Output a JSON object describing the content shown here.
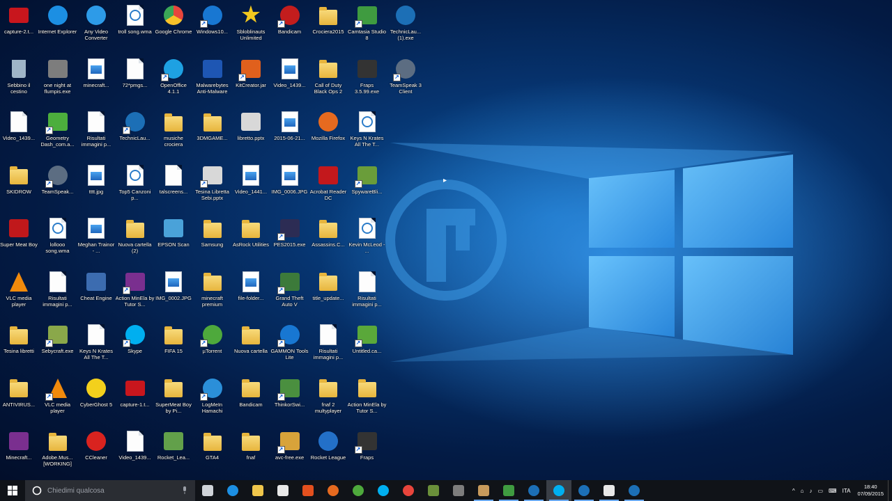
{
  "desktop": {
    "icons": [
      {
        "label": "capture-2.t...",
        "type": "video",
        "color": "#c8161d"
      },
      {
        "label": "Internet Explorer",
        "type": "ie",
        "color": "#1c8fe3"
      },
      {
        "label": "Any Video Converter",
        "type": "round",
        "color": "#2d9be8"
      },
      {
        "label": "troll song.wma",
        "type": "media",
        "color": "#2b7cc9"
      },
      {
        "label": "Google Chrome",
        "type": "chrome",
        "color": "#e8453c"
      },
      {
        "label": "Windows10...",
        "type": "round",
        "color": "#1877d2"
      },
      {
        "label": "Sbloblinauts Unlimited",
        "type": "star",
        "color": "#f3c81e"
      },
      {
        "label": "Bandicam",
        "type": "round",
        "color": "#c31d1d"
      },
      {
        "label": "Crociera2015",
        "type": "folder"
      },
      {
        "label": "Camtasia Studio 8",
        "type": "sq",
        "color": "#3f9b40"
      },
      {
        "label": "TechnicLau... (1).exe",
        "type": "round",
        "color": "#1c6fb6"
      },
      {
        "label": "Sebbino il cestino",
        "type": "bin",
        "color": "#9fb5c8"
      },
      {
        "label": "one night at flumpis.exe",
        "type": "sq",
        "color": "#7d7d7d"
      },
      {
        "label": "minecraft...",
        "type": "image"
      },
      {
        "label": "72*pmgs...",
        "type": "file"
      },
      {
        "label": "OpenOffice 4.1.1",
        "type": "round",
        "color": "#1ea1e2"
      },
      {
        "label": "Malwarebytes Anti-Malware",
        "type": "sq",
        "color": "#1e56b3"
      },
      {
        "label": "KitCreator.jar",
        "type": "sq",
        "color": "#e0601d"
      },
      {
        "label": "Video_1439...",
        "type": "image"
      },
      {
        "label": "Call of Duty Black Ops 2",
        "type": "folder"
      },
      {
        "label": "Fraps 3.5.99.exe",
        "type": "sq",
        "color": "#333333"
      },
      {
        "label": "TeamSpeak 3 Client",
        "type": "round",
        "color": "#5c6d82"
      },
      {
        "label": "Video_1439...",
        "type": "file"
      },
      {
        "label": "Geometry Dash_com.a...",
        "type": "sq",
        "color": "#4cae3d"
      },
      {
        "label": "Risultati immagini p...",
        "type": "file"
      },
      {
        "label": "TechnicLau...",
        "type": "round",
        "color": "#1c6fb6"
      },
      {
        "label": "musiche crociera",
        "type": "folder"
      },
      {
        "label": "3DMGAME...",
        "type": "folder"
      },
      {
        "label": "libretto.pptx",
        "type": "sq",
        "color": "#d8d8d8"
      },
      {
        "label": "2015-06-21...",
        "type": "image"
      },
      {
        "label": "Mozilla Firefox",
        "type": "round",
        "color": "#e66a1f"
      },
      {
        "label": "Keys N Krates All The T...",
        "type": "media",
        "color": "#2b7cc9"
      },
      {
        "label": "SKIDROW",
        "type": "folder"
      },
      {
        "label": "TeamSpeak...",
        "type": "round",
        "color": "#5c6d82"
      },
      {
        "label": "tttt.jpg",
        "type": "image"
      },
      {
        "label": "Top5 Canzoni p...",
        "type": "media",
        "color": "#2b7cc9"
      },
      {
        "label": "talscreens...",
        "type": "file"
      },
      {
        "label": "Tesina Libretta Sebi.pptx",
        "type": "sq",
        "color": "#d8d8d8"
      },
      {
        "label": "Video_1441...",
        "type": "image"
      },
      {
        "label": "IMG_0006.JPG",
        "type": "image"
      },
      {
        "label": "Acrobat Reader DC",
        "type": "sq",
        "color": "#c3181c"
      },
      {
        "label": "SpywareBli...",
        "type": "sq",
        "color": "#6a9d3a"
      },
      {
        "label": "Super Meat Boy",
        "type": "sq",
        "color": "#c0181b"
      },
      {
        "label": "lollooo song.wma",
        "type": "media",
        "color": "#2b7cc9"
      },
      {
        "label": "Meghan Trainor - ...",
        "type": "image"
      },
      {
        "label": "Nuova cartella (2)",
        "type": "folder"
      },
      {
        "label": "EPSON Scan",
        "type": "sq",
        "color": "#4aa2d9"
      },
      {
        "label": "Samsung",
        "type": "folder"
      },
      {
        "label": "AsRock Utilities",
        "type": "folder"
      },
      {
        "label": "PES2015.exe",
        "type": "sq",
        "color": "#2c2c54"
      },
      {
        "label": "Assassins.C...",
        "type": "folder"
      },
      {
        "label": "Kevin McLeod - ...",
        "type": "media",
        "color": "#2b7cc9"
      },
      {
        "label": "VLC media player",
        "type": "vlc",
        "color": "#f18a0c"
      },
      {
        "label": "Risultati immagini p...",
        "type": "file"
      },
      {
        "label": "Cheat Engine",
        "type": "sq",
        "color": "#3c6cb0"
      },
      {
        "label": "Action MinEla by Tutor S...",
        "type": "sq",
        "color": "#7a2f8f"
      },
      {
        "label": "IMG_0002.JPG",
        "type": "image"
      },
      {
        "label": "minecraft premium",
        "type": "folder"
      },
      {
        "label": "file-folder...",
        "type": "image"
      },
      {
        "label": "Grand Theft Auto V",
        "type": "sq",
        "color": "#3c7a3a"
      },
      {
        "label": "title_update...",
        "type": "folder"
      },
      {
        "label": "Risultati immagini p...",
        "type": "file"
      },
      {
        "label": "Tesina libretti",
        "type": "folder"
      },
      {
        "label": "Sebycraft.exe",
        "type": "sq",
        "color": "#8aa84a"
      },
      {
        "label": "Keys N Krates All The T...",
        "type": "file"
      },
      {
        "label": "Skype",
        "type": "round",
        "color": "#00aff0"
      },
      {
        "label": "FIFA 15",
        "type": "folder"
      },
      {
        "label": "µTorrent",
        "type": "round",
        "color": "#4ea93c"
      },
      {
        "label": "Nuova cartella",
        "type": "folder"
      },
      {
        "label": "GAMMON Tools Lite",
        "type": "round",
        "color": "#1877d2"
      },
      {
        "label": "Risultati immagini p...",
        "type": "file"
      },
      {
        "label": "Untitled.ca...",
        "type": "sq",
        "color": "#5aa83a"
      },
      {
        "label": "ANTIVIRUS...",
        "type": "folder"
      },
      {
        "label": "VLC media player",
        "type": "vlc",
        "color": "#f18a0c"
      },
      {
        "label": "CyberGhost 5",
        "type": "round",
        "color": "#f3d01c"
      },
      {
        "label": "capture-1.t...",
        "type": "video",
        "color": "#c8161d"
      },
      {
        "label": "SuperMeat Boy by Pi...",
        "type": "folder"
      },
      {
        "label": "LogMeIn Hamachi",
        "type": "round",
        "color": "#2b8fd9"
      },
      {
        "label": "Bandicam",
        "type": "folder"
      },
      {
        "label": "ThinkorSwi...",
        "type": "sq",
        "color": "#4a8f3f"
      },
      {
        "label": "fnaf 2 multyplayer",
        "type": "folder"
      },
      {
        "label": "Action MinEla by Tutor S...",
        "type": "folder"
      },
      {
        "label": "Minecraft...",
        "type": "sq",
        "color": "#7a2f8f"
      },
      {
        "label": "Adobe.Mus... [WORKING]",
        "type": "folder"
      },
      {
        "label": "CCleaner",
        "type": "round",
        "color": "#d9231f"
      },
      {
        "label": "Video_1439...",
        "type": "file"
      },
      {
        "label": "Rocket_Lea...",
        "type": "sq",
        "color": "#62a04a"
      },
      {
        "label": "GTA4",
        "type": "folder"
      },
      {
        "label": "fnaf",
        "type": "folder"
      },
      {
        "label": "avc-free.exe",
        "type": "sq",
        "color": "#d8a33a"
      },
      {
        "label": "Rocket League",
        "type": "round",
        "color": "#2370c8"
      },
      {
        "label": "Fraps",
        "type": "sq",
        "color": "#333333"
      }
    ],
    "wallpaper_logo_letter": "f"
  },
  "taskbar": {
    "search_placeholder": "Chiedimi qualcosa",
    "pinned": [
      {
        "name": "task-view",
        "color": "#cfd3d8"
      },
      {
        "name": "edge",
        "color": "#1c8fe3"
      },
      {
        "name": "file-explorer",
        "color": "#f0c64b"
      },
      {
        "name": "store",
        "color": "#e8e8e8"
      },
      {
        "name": "office",
        "color": "#e3501e"
      },
      {
        "name": "firefox",
        "color": "#e66a1f"
      },
      {
        "name": "utorrent",
        "color": "#4ea93c"
      },
      {
        "name": "skype",
        "color": "#00aff0"
      },
      {
        "name": "chrome",
        "color": "#e8453c"
      },
      {
        "name": "minecraft",
        "color": "#6a8f3a"
      },
      {
        "name": "calculator",
        "color": "#7d7d7d"
      },
      {
        "name": "package",
        "color": "#c79a5c"
      },
      {
        "name": "camtasia",
        "color": "#3f9b40"
      },
      {
        "name": "technic",
        "color": "#1c6fb6"
      },
      {
        "name": "skype-2",
        "color": "#00aff0"
      },
      {
        "name": "technic-2",
        "color": "#1c6fb6"
      },
      {
        "name": "camtasia-recorder",
        "color": "#e8e8e8"
      },
      {
        "name": "technic-3",
        "color": "#1c6fb6"
      }
    ],
    "tray": {
      "chevron": "^",
      "lang": "ITA",
      "time": "18:40",
      "date": "07/09/2015"
    }
  }
}
